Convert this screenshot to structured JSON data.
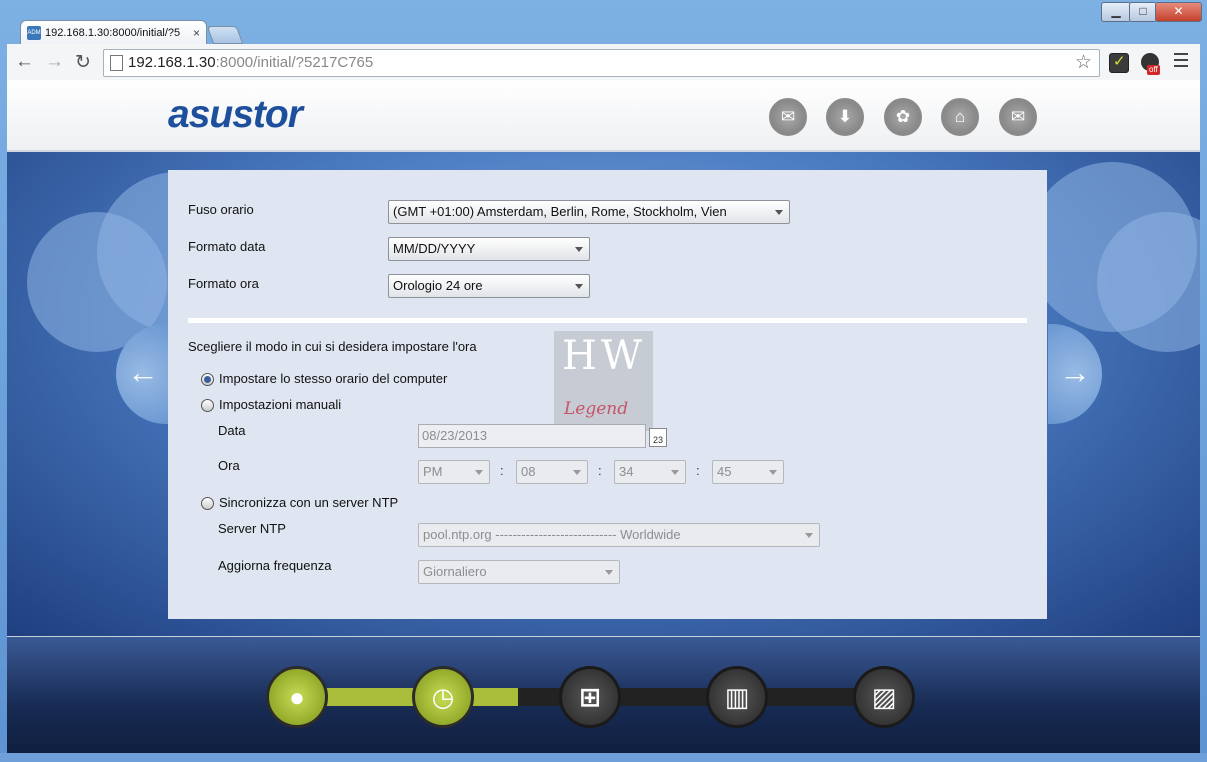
{
  "browser": {
    "tab_title": "192.168.1.30:8000/initial/?5",
    "tab_favicon": "ADM",
    "tab_close": "×",
    "window_controls": {
      "minimize": "▁",
      "maximize": "□",
      "close": "✕"
    },
    "nav": {
      "back": "←",
      "forward": "→",
      "reload": "↻"
    },
    "url_host": "192.168.1.30",
    "url_rest": ":8000/initial/?5217C765",
    "star": "☆",
    "ext_badge": "off"
  },
  "header": {
    "logo": "asustor",
    "icons": [
      {
        "name": "chat-icon",
        "glyph": "✉"
      },
      {
        "name": "download-icon",
        "glyph": "⬇"
      },
      {
        "name": "settings-icon",
        "glyph": "✿"
      },
      {
        "name": "bank-icon",
        "glyph": "⌂"
      },
      {
        "name": "mail-icon",
        "glyph": "✉"
      }
    ]
  },
  "form": {
    "timezone_label": "Fuso orario",
    "timezone_value": "(GMT +01:00) Amsterdam, Berlin, Rome, Stockholm, Vien",
    "date_format_label": "Formato data",
    "date_format_value": "MM/DD/YYYY",
    "time_format_label": "Formato ora",
    "time_format_value": "Orologio 24 ore",
    "section_label": "Scegliere il modo in cui si desidera impostare l'ora",
    "option_computer": "Impostare lo stesso orario del computer",
    "option_manual": "Impostazioni manuali",
    "date_label": "Data",
    "date_value": "08/23/2013",
    "calendar_day": "23",
    "time_label": "Ora",
    "ampm": "PM",
    "hour": "08",
    "minute": "34",
    "second": "45",
    "colon": ":",
    "option_ntp": "Sincronizza con un server NTP",
    "ntp_label": "Server NTP",
    "ntp_value": "pool.ntp.org ---------------------------- Worldwide",
    "freq_label": "Aggiorna frequenza",
    "freq_value": "Giornaliero",
    "selected_option": "computer"
  },
  "watermark": {
    "top": "HW",
    "bottom": "Legend"
  },
  "nav_arrows": {
    "prev": "←",
    "next": "→"
  },
  "steps": [
    {
      "name": "user-icon",
      "glyph": "●",
      "state": "done"
    },
    {
      "name": "clock-icon",
      "glyph": "◷",
      "state": "done"
    },
    {
      "name": "network-icon",
      "glyph": "⊞",
      "state": "todo"
    },
    {
      "name": "storage-icon",
      "glyph": "▥",
      "state": "todo"
    },
    {
      "name": "disk-icon",
      "glyph": "▨",
      "state": "todo"
    }
  ],
  "colors": {
    "brand": "#1d4f9c",
    "accent": "#a9bd3b"
  }
}
